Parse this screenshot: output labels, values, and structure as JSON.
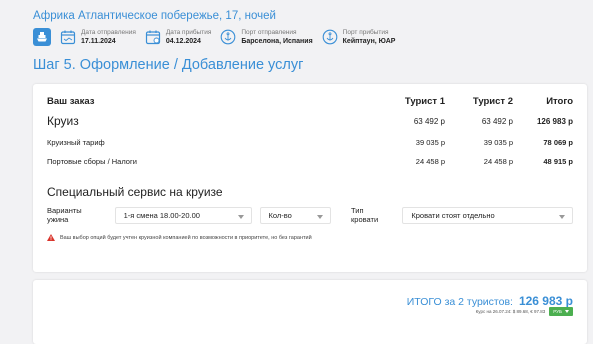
{
  "trip": {
    "title": "Африка Атлантическое побережье, 17, ночей",
    "departure_date_label": "Дата отправления",
    "departure_date": "17.11.2024",
    "arrival_date_label": "Дата прибытия",
    "arrival_date": "04.12.2024",
    "departure_port_label": "Порт отправления",
    "departure_port": "Барселона, Испания",
    "arrival_port_label": "Порт прибытия",
    "arrival_port": "Кейптаун, ЮАР"
  },
  "step_title": "Шаг 5.  Оформление / Добавление услуг",
  "order": {
    "header": {
      "title": "Ваш заказ",
      "t1": "Турист 1",
      "t2": "Турист 2",
      "total": "Итого"
    },
    "rows": [
      {
        "name": "Круиз",
        "t1": "63 492 р",
        "t2": "63 492 р",
        "total": "126 983 р"
      },
      {
        "name": "Круизный тариф",
        "t1": "39 035 р",
        "t2": "39 035 р",
        "total": "78 069 р"
      },
      {
        "name": "Портовые сборы / Налоги",
        "t1": "24 458 р",
        "t2": "24 458 р",
        "total": "48 915 р"
      }
    ]
  },
  "service": {
    "title": "Специальный сервис на круизе",
    "dinner_label": "Варианты ужина",
    "dinner_value": "1-я смена 18.00-20.00",
    "qty_value": "Кол-во",
    "bed_label": "Тип кровати",
    "bed_value": "Кровати стоят отдельно",
    "warning": "Ваш выбор опций будет учтен круизной компанией по возможности в приоритете, но без гарантий"
  },
  "total": {
    "label": "ИТОГО за 2 туристов:",
    "amount": "126 983 р",
    "rate_text": "Курс на 26.07.24: $ 89.68, € 97.83",
    "currency": "РУБ"
  },
  "colors": {
    "accent": "#3a8fd6",
    "warning": "#d9342b",
    "currency_button": "#4caf50"
  }
}
